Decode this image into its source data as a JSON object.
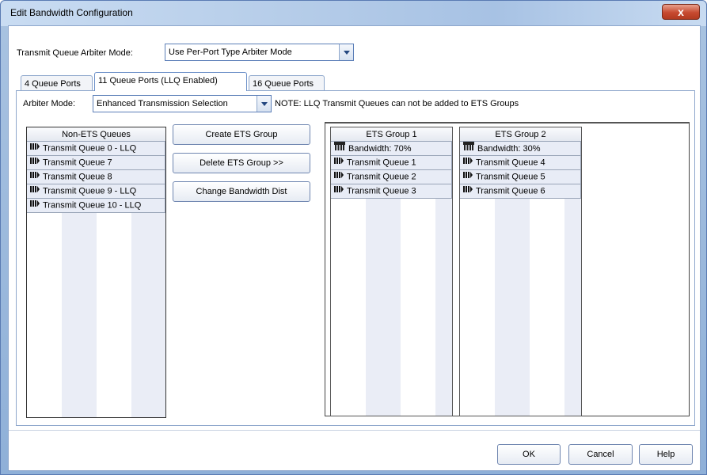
{
  "window": {
    "title": "Edit Bandwidth Configuration",
    "close_label": "x"
  },
  "arbiter": {
    "label": "Transmit Queue Arbiter Mode:",
    "value": "Use Per-Port Type Arbiter Mode"
  },
  "tabs": [
    {
      "label": "4 Queue Ports"
    },
    {
      "label": "11 Queue Ports (LLQ Enabled)"
    },
    {
      "label": "16 Queue Ports"
    }
  ],
  "panel": {
    "arbiter_label": "Arbiter Mode:",
    "arbiter_value": "Enhanced Transmission Selection",
    "note": "NOTE: LLQ Transmit Queues can not be added to ETS Groups"
  },
  "non_ets": {
    "header": "Non-ETS Queues",
    "items": [
      "Transmit Queue 0 - LLQ",
      "Transmit Queue 7",
      "Transmit Queue 8",
      "Transmit Queue 9 - LLQ",
      "Transmit Queue 10 - LLQ"
    ]
  },
  "actions": {
    "create": "Create ETS Group",
    "delete": "Delete ETS Group >>",
    "change": "Change Bandwidth Dist"
  },
  "groups": [
    {
      "header": "ETS Group 1",
      "bandwidth": "Bandwidth: 70%",
      "items": [
        "Transmit Queue 1",
        "Transmit Queue 2",
        "Transmit Queue 3"
      ]
    },
    {
      "header": "ETS Group 2",
      "bandwidth": "Bandwidth: 30%",
      "items": [
        "Transmit Queue 4",
        "Transmit Queue 5",
        "Transmit Queue 6"
      ]
    }
  ],
  "footer": {
    "ok": "OK",
    "cancel": "Cancel",
    "help": "Help"
  },
  "icons": {
    "queue": "queue-icon",
    "bandwidth": "bandwidth-icon"
  },
  "colors": {
    "accent": "#5c7fb8",
    "selection_row": "#e8ecf6",
    "title_bar": "#b6cde9"
  }
}
